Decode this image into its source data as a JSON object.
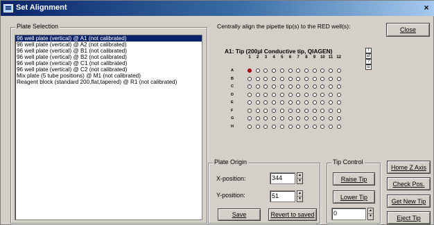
{
  "window": {
    "title": "Set Alignment",
    "close_glyph": "×"
  },
  "plate_selection": {
    "legend": "Plate Selection",
    "items": [
      "96 well plate (vertical) @ A1 (not calibrated)",
      "96 well plate (vertical) @ A2 (not calibrated)",
      "96 well plate (vertical) @ B1 (not calibrated)",
      "96 well plate (vertical) @ B2 (not calibrated)",
      "96 well plate (vertical) @ C1 (not calibrated)",
      "96 well plate (vertical) @ C2 (not calibrated)",
      "Mix plate (5 tube positions) @ M1 (not calibrated)",
      "Reagent block (standard 200,flat,tapered) @ R1 (not calibrated)"
    ],
    "selected_index": 0
  },
  "instruction": "Centrally align the pipette tip(s) to the RED well(s):",
  "plate_view": {
    "title": "A1: Tip (200µl Conductive tip, QIAGEN)",
    "columns": [
      "1",
      "2",
      "3",
      "4",
      "5",
      "6",
      "7",
      "8",
      "9",
      "10",
      "11",
      "12"
    ],
    "rows": [
      "A",
      "B",
      "C",
      "D",
      "E",
      "F",
      "G",
      "H"
    ],
    "target_well": "A1",
    "side_icons": [
      "!",
      "⇄",
      "?",
      "☰"
    ]
  },
  "buttons": {
    "close": "Close",
    "home_z_axis": "Home Z Axis",
    "check_pos": "Check Pos.",
    "get_new_tip": "Get New Tip",
    "eject_tip": "Eject Tip",
    "raise_tip": "Raise Tip",
    "lower_tip": "Lower Tip",
    "save": "Save",
    "revert": "Revert to saved"
  },
  "plate_origin": {
    "legend": "Plate Origin",
    "x_label": "X-position:",
    "x_value": "344",
    "y_label": "Y-position:",
    "y_value": "51"
  },
  "tip_control": {
    "legend": "Tip Control",
    "step_value": "0"
  },
  "colors": {
    "title_gradient_start": "#0a246a",
    "selection": "#0a246a",
    "target_well": "#c00000",
    "face": "#d4d0c8"
  }
}
